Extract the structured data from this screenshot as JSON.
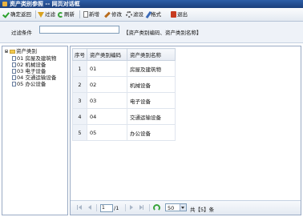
{
  "window": {
    "title": "资产类别参照 -- 网页对话框"
  },
  "toolbar": {
    "confirm_return": "确定返回",
    "filter": "过滤",
    "refresh": "刷新",
    "new": "新增",
    "edit": "修改",
    "filter_settings": "滤设",
    "format": "格式",
    "exit": "退出"
  },
  "filter": {
    "label": "过滤条件",
    "value": "",
    "hint": "【资产类别编码、资产类别名称】"
  },
  "tree": {
    "root": "资产类别",
    "items": [
      "01 房屋及建筑物",
      "02 机械设备",
      "03 电子设备",
      "04 交通运输设备",
      "05 办公设备"
    ]
  },
  "grid": {
    "columns": [
      "序号",
      "资产类别编码",
      "资产类别名称"
    ],
    "rows": [
      [
        "1",
        "01",
        "房屋及建筑物"
      ],
      [
        "2",
        "02",
        "机械设备"
      ],
      [
        "3",
        "03",
        "电子设备"
      ],
      [
        "4",
        "04",
        "交通运输设备"
      ],
      [
        "5",
        "05",
        "办公设备"
      ]
    ]
  },
  "pager": {
    "page": "1",
    "total": "/1",
    "page_size": "50",
    "count": "共【5】条"
  }
}
